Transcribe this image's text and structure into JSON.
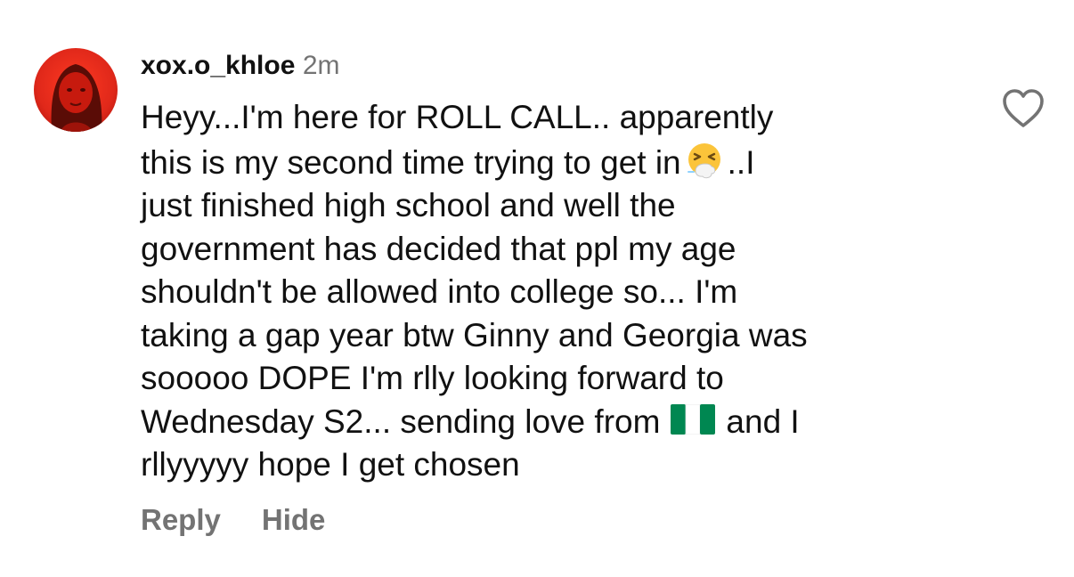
{
  "comment": {
    "username": "xox.o_khloe",
    "timestamp": "2m",
    "avatar_icon": "profile-photo-red",
    "body_lines": [
      {
        "segments": [
          "Heyy...I'm here for ROLL CALL.. apparently"
        ]
      },
      {
        "segments": [
          "this is my second time trying to get in",
          "..I"
        ],
        "emoji": "sneezing-face-emoji"
      },
      {
        "segments": [
          "just finished high school and well the"
        ]
      },
      {
        "segments": [
          "government has decided that ppl my age"
        ]
      },
      {
        "segments": [
          "shouldn't be allowed into college so... I'm"
        ]
      },
      {
        "segments": [
          "taking a gap year btw Ginny and Georgia was"
        ]
      },
      {
        "segments": [
          "sooooo DOPE I'm rlly looking forward to"
        ]
      },
      {
        "segments": [
          "Wednesday S2... sending love from",
          "and I"
        ],
        "emoji": "nigeria-flag-emoji"
      },
      {
        "segments": [
          "rllyyyyy hope I get chosen"
        ]
      }
    ],
    "like_icon": "heart-outline-icon",
    "actions": {
      "reply_label": "Reply",
      "hide_label": "Hide"
    }
  },
  "colors": {
    "text": "#111111",
    "secondary": "#737373",
    "avatar_red": "#e0281a",
    "flag_green": "#008751"
  }
}
